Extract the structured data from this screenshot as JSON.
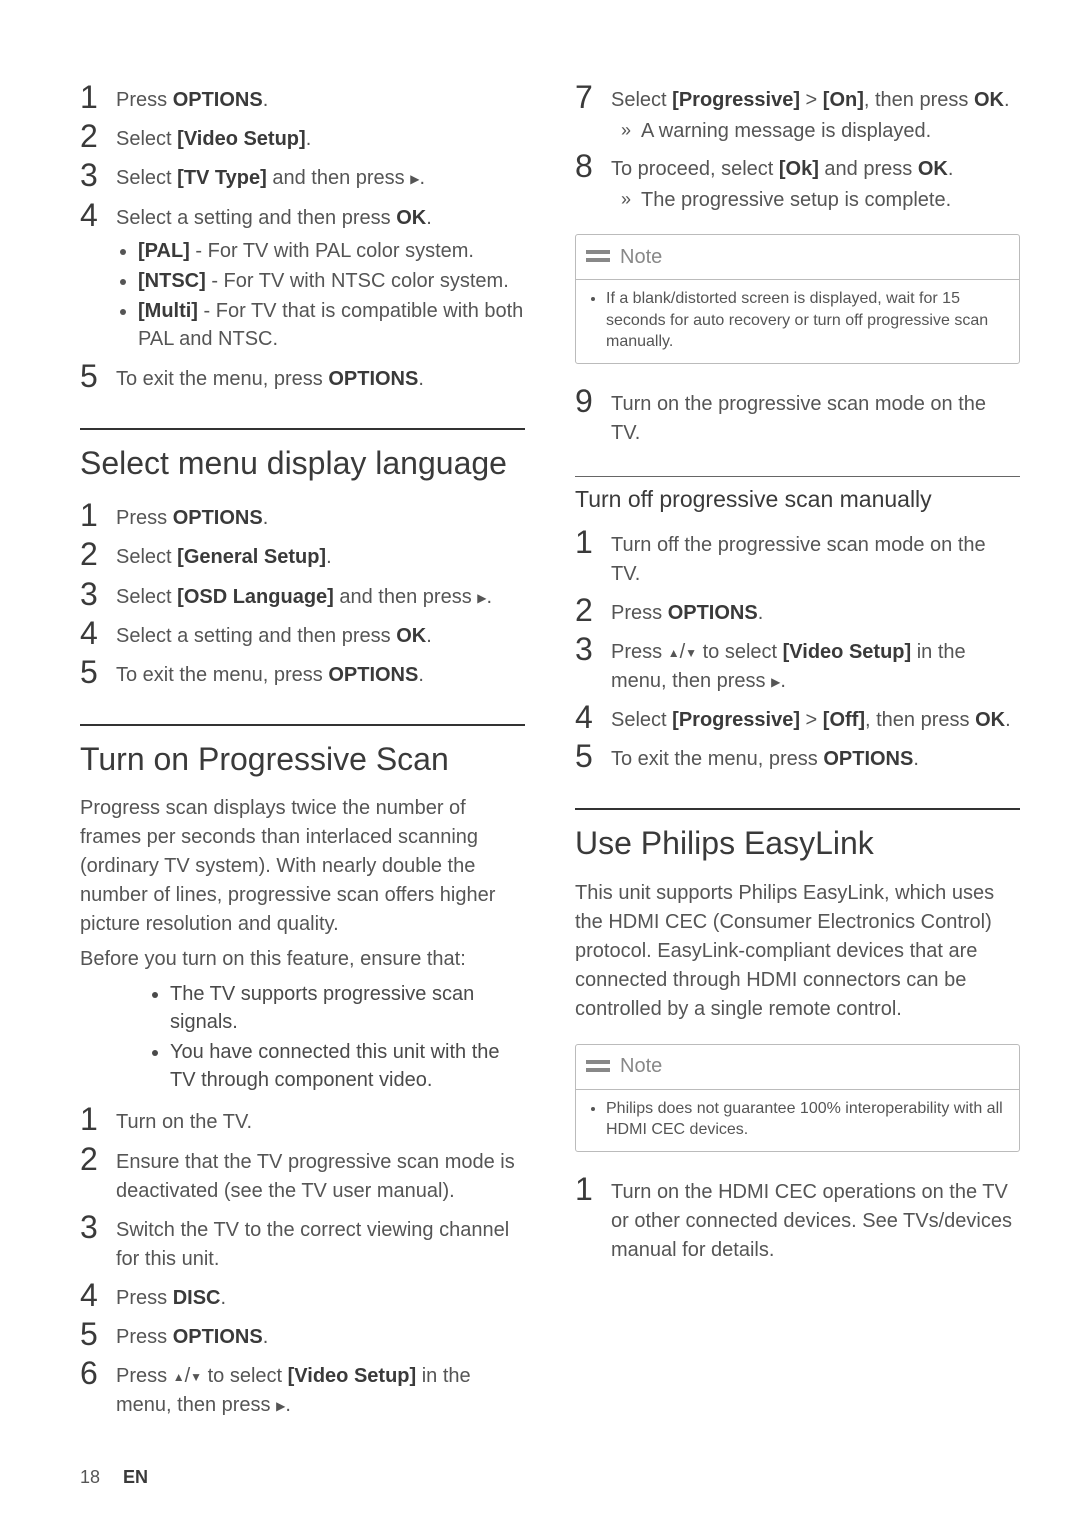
{
  "left": {
    "block1": {
      "s1": "Press <b>OPTIONS</b>.",
      "s2": "Select <b>[Video Setup]</b>.",
      "s3": "Select <b>[TV Type]</b> and then press <span class='tri-right'></span>.",
      "s4": "Select a setting and then press <b>OK</b>.",
      "s4_b1": "<b>[PAL]</b> - For TV with PAL color system.",
      "s4_b2": "<b>[NTSC]</b> - For TV with NTSC color system.",
      "s4_b3": "<b>[Multi]</b> -  For TV that is compatible with both PAL and NTSC.",
      "s5": "To exit the menu, press <b>OPTIONS</b>."
    },
    "sec2_title": "Select menu display language",
    "block2": {
      "s1": "Press <b>OPTIONS</b>.",
      "s2": "Select <b>[General Setup]</b>.",
      "s3": "Select <b>[OSD Language]</b> and then press <span class='tri-right'></span>.",
      "s4": "Select a setting and then press <b>OK</b>.",
      "s5": "To exit the menu, press <b>OPTIONS</b>."
    },
    "sec3_title": "Turn on Progressive Scan",
    "sec3_para1": "Progress scan displays twice the number of frames per seconds than interlaced scanning (ordinary TV system). With nearly double the number of lines, progressive scan offers higher picture resolution and quality.",
    "sec3_para2": "Before you turn on this feature, ensure that:",
    "sec3_b1": "The TV supports progressive scan signals.",
    "sec3_b2": "You have connected this unit with the TV through component video.",
    "block3": {
      "s1": "Turn on the TV.",
      "s2": "Ensure that the TV progressive scan mode is deactivated (see the TV user manual).",
      "s3": "Switch the TV to the correct viewing channel for this unit.",
      "s4": "Press <b>DISC</b>.",
      "s5": "Press <b>OPTIONS</b>.",
      "s6": "Press <span class='tri-up'></span>/<span class='tri-down'></span> to select <b>[Video Setup]</b> in the menu, then press <span class='tri-right'></span>."
    }
  },
  "right": {
    "block1": {
      "s7": "Select <b>[Progressive]</b> > <b>[On]</b>, then press <b>OK</b>.",
      "s7_r": "A warning message is displayed.",
      "s8": "To proceed, select <b>[Ok]</b> and press <b>OK</b>.",
      "s8_r": "The progressive setup is complete."
    },
    "note1_title": "Note",
    "note1_body": "If a blank/distorted screen is displayed, wait for 15 seconds for auto recovery or turn off progressive scan manually.",
    "block1b": {
      "s9": "Turn on the progressive scan mode on the TV."
    },
    "sub1_title": "Turn off progressive scan manually",
    "block2": {
      "s1": "Turn off the progressive scan mode on the TV.",
      "s2": "Press <b>OPTIONS</b>.",
      "s3": "Press <span class='tri-up'></span>/<span class='tri-down'></span> to select <b>[Video Setup]</b> in the menu, then press <span class='tri-right'></span>.",
      "s4": "Select <b>[Progressive]</b> > <b>[Off]</b>, then press <b>OK</b>.",
      "s5": "To exit the menu, press <b>OPTIONS</b>."
    },
    "sec2_title": "Use Philips EasyLink",
    "sec2_para": "This unit supports Philips EasyLink, which uses the HDMI CEC (Consumer Electronics Control) protocol. EasyLink-compliant devices that are connected through HDMI connectors can be controlled by a single remote control.",
    "note2_title": "Note",
    "note2_body": "Philips does not guarantee 100% interoperability with all HDMI CEC devices.",
    "block3": {
      "s1": "Turn on the HDMI CEC operations on the TV or other connected devices. See TVs/devices manual for details."
    }
  },
  "footer": {
    "page": "18",
    "lang": "EN"
  }
}
